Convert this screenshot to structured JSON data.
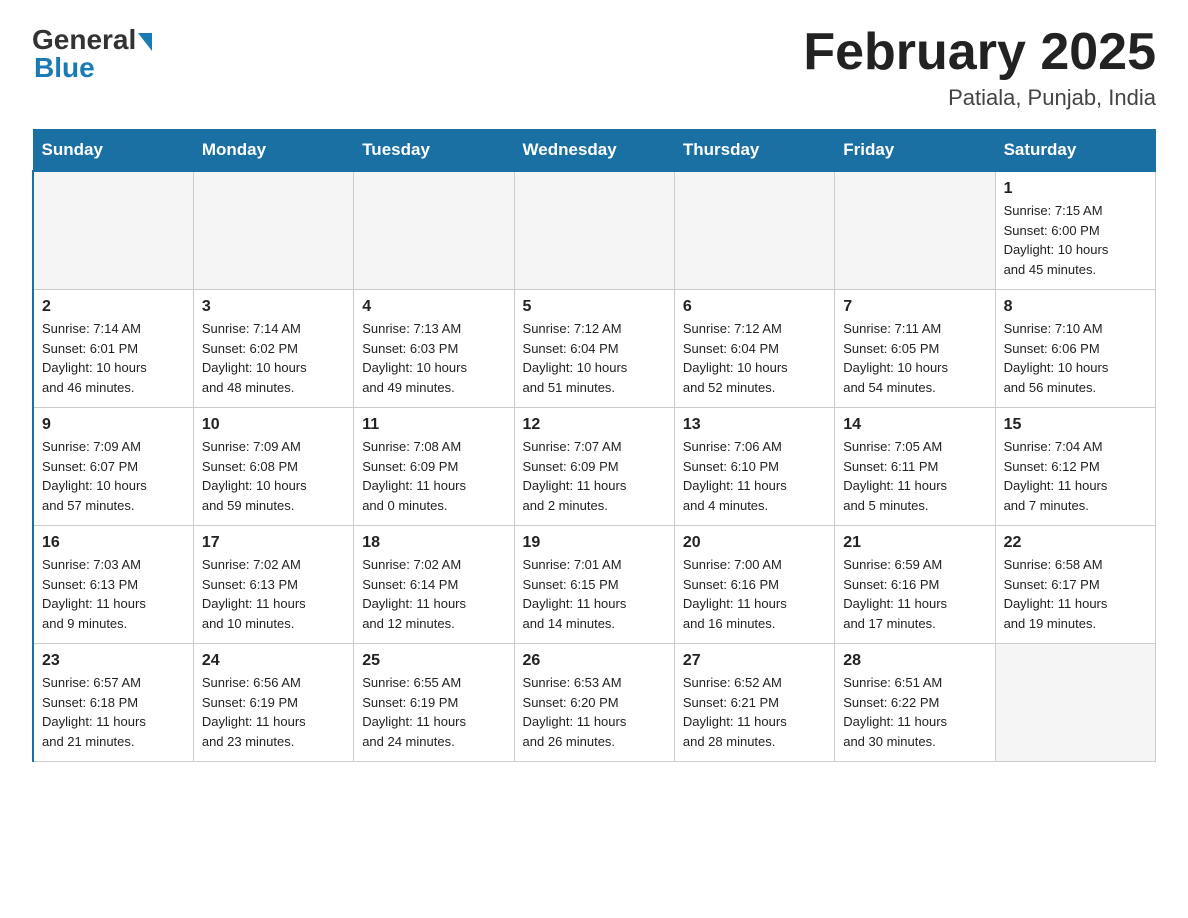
{
  "logo": {
    "general": "General",
    "blue": "Blue"
  },
  "title": "February 2025",
  "location": "Patiala, Punjab, India",
  "days_of_week": [
    "Sunday",
    "Monday",
    "Tuesday",
    "Wednesday",
    "Thursday",
    "Friday",
    "Saturday"
  ],
  "weeks": [
    [
      {
        "day": "",
        "info": ""
      },
      {
        "day": "",
        "info": ""
      },
      {
        "day": "",
        "info": ""
      },
      {
        "day": "",
        "info": ""
      },
      {
        "day": "",
        "info": ""
      },
      {
        "day": "",
        "info": ""
      },
      {
        "day": "1",
        "info": "Sunrise: 7:15 AM\nSunset: 6:00 PM\nDaylight: 10 hours\nand 45 minutes."
      }
    ],
    [
      {
        "day": "2",
        "info": "Sunrise: 7:14 AM\nSunset: 6:01 PM\nDaylight: 10 hours\nand 46 minutes."
      },
      {
        "day": "3",
        "info": "Sunrise: 7:14 AM\nSunset: 6:02 PM\nDaylight: 10 hours\nand 48 minutes."
      },
      {
        "day": "4",
        "info": "Sunrise: 7:13 AM\nSunset: 6:03 PM\nDaylight: 10 hours\nand 49 minutes."
      },
      {
        "day": "5",
        "info": "Sunrise: 7:12 AM\nSunset: 6:04 PM\nDaylight: 10 hours\nand 51 minutes."
      },
      {
        "day": "6",
        "info": "Sunrise: 7:12 AM\nSunset: 6:04 PM\nDaylight: 10 hours\nand 52 minutes."
      },
      {
        "day": "7",
        "info": "Sunrise: 7:11 AM\nSunset: 6:05 PM\nDaylight: 10 hours\nand 54 minutes."
      },
      {
        "day": "8",
        "info": "Sunrise: 7:10 AM\nSunset: 6:06 PM\nDaylight: 10 hours\nand 56 minutes."
      }
    ],
    [
      {
        "day": "9",
        "info": "Sunrise: 7:09 AM\nSunset: 6:07 PM\nDaylight: 10 hours\nand 57 minutes."
      },
      {
        "day": "10",
        "info": "Sunrise: 7:09 AM\nSunset: 6:08 PM\nDaylight: 10 hours\nand 59 minutes."
      },
      {
        "day": "11",
        "info": "Sunrise: 7:08 AM\nSunset: 6:09 PM\nDaylight: 11 hours\nand 0 minutes."
      },
      {
        "day": "12",
        "info": "Sunrise: 7:07 AM\nSunset: 6:09 PM\nDaylight: 11 hours\nand 2 minutes."
      },
      {
        "day": "13",
        "info": "Sunrise: 7:06 AM\nSunset: 6:10 PM\nDaylight: 11 hours\nand 4 minutes."
      },
      {
        "day": "14",
        "info": "Sunrise: 7:05 AM\nSunset: 6:11 PM\nDaylight: 11 hours\nand 5 minutes."
      },
      {
        "day": "15",
        "info": "Sunrise: 7:04 AM\nSunset: 6:12 PM\nDaylight: 11 hours\nand 7 minutes."
      }
    ],
    [
      {
        "day": "16",
        "info": "Sunrise: 7:03 AM\nSunset: 6:13 PM\nDaylight: 11 hours\nand 9 minutes."
      },
      {
        "day": "17",
        "info": "Sunrise: 7:02 AM\nSunset: 6:13 PM\nDaylight: 11 hours\nand 10 minutes."
      },
      {
        "day": "18",
        "info": "Sunrise: 7:02 AM\nSunset: 6:14 PM\nDaylight: 11 hours\nand 12 minutes."
      },
      {
        "day": "19",
        "info": "Sunrise: 7:01 AM\nSunset: 6:15 PM\nDaylight: 11 hours\nand 14 minutes."
      },
      {
        "day": "20",
        "info": "Sunrise: 7:00 AM\nSunset: 6:16 PM\nDaylight: 11 hours\nand 16 minutes."
      },
      {
        "day": "21",
        "info": "Sunrise: 6:59 AM\nSunset: 6:16 PM\nDaylight: 11 hours\nand 17 minutes."
      },
      {
        "day": "22",
        "info": "Sunrise: 6:58 AM\nSunset: 6:17 PM\nDaylight: 11 hours\nand 19 minutes."
      }
    ],
    [
      {
        "day": "23",
        "info": "Sunrise: 6:57 AM\nSunset: 6:18 PM\nDaylight: 11 hours\nand 21 minutes."
      },
      {
        "day": "24",
        "info": "Sunrise: 6:56 AM\nSunset: 6:19 PM\nDaylight: 11 hours\nand 23 minutes."
      },
      {
        "day": "25",
        "info": "Sunrise: 6:55 AM\nSunset: 6:19 PM\nDaylight: 11 hours\nand 24 minutes."
      },
      {
        "day": "26",
        "info": "Sunrise: 6:53 AM\nSunset: 6:20 PM\nDaylight: 11 hours\nand 26 minutes."
      },
      {
        "day": "27",
        "info": "Sunrise: 6:52 AM\nSunset: 6:21 PM\nDaylight: 11 hours\nand 28 minutes."
      },
      {
        "day": "28",
        "info": "Sunrise: 6:51 AM\nSunset: 6:22 PM\nDaylight: 11 hours\nand 30 minutes."
      },
      {
        "day": "",
        "info": ""
      }
    ]
  ]
}
